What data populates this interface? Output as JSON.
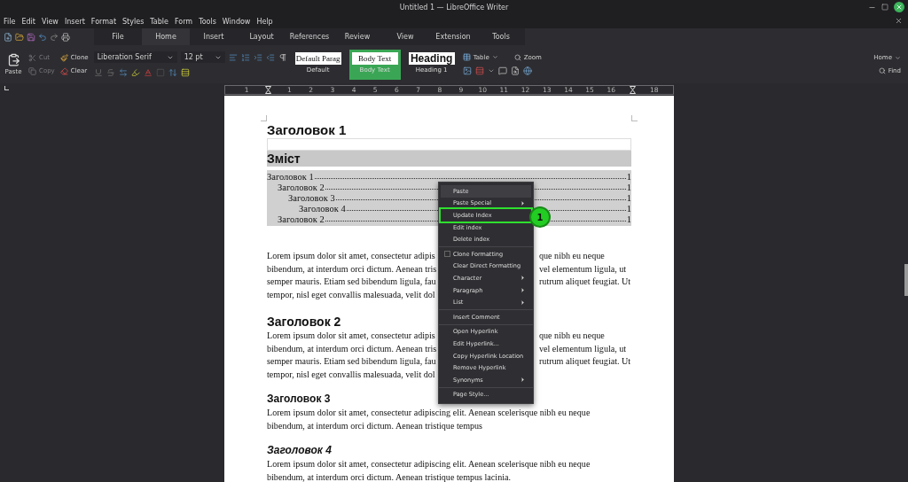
{
  "window": {
    "title": "Untitled 1 — LibreOffice Writer"
  },
  "menubar": [
    "File",
    "Edit",
    "View",
    "Insert",
    "Format",
    "Styles",
    "Table",
    "Form",
    "Tools",
    "Window",
    "Help"
  ],
  "tabs": [
    {
      "label": "File",
      "selected": false
    },
    {
      "label": "Home",
      "selected": true
    },
    {
      "label": "Insert",
      "selected": false
    },
    {
      "label": "Layout",
      "selected": false
    },
    {
      "label": "References",
      "selected": false
    },
    {
      "label": "Review",
      "selected": false
    },
    {
      "label": "View",
      "selected": false
    },
    {
      "label": "Extension",
      "selected": false
    },
    {
      "label": "Tools",
      "selected": false
    }
  ],
  "ribbon": {
    "paste": "Paste",
    "cut": {
      "label": "Cut",
      "disabled": true
    },
    "copy": {
      "label": "Copy",
      "disabled": true
    },
    "clone": {
      "label": "Clone",
      "disabled": false
    },
    "clear": {
      "label": "Clear",
      "disabled": false
    },
    "font_name": "Liberation Serif",
    "font_size": "12 pt",
    "styles": [
      {
        "preview": "Default Parag",
        "label": "Default",
        "selected": false,
        "kind": "paragraph"
      },
      {
        "preview": "Body Text",
        "label": "Body Text",
        "selected": true,
        "kind": "paragraph"
      },
      {
        "preview": "Heading",
        "label": "Heading 1",
        "selected": false,
        "kind": "heading"
      }
    ],
    "table": "Table",
    "zoom": "Zoom",
    "home_menu": "Home",
    "find": "Find"
  },
  "ruler": [
    {
      "kind": "number",
      "label": "1"
    },
    {
      "kind": "marker"
    },
    {
      "kind": "number",
      "label": "1"
    },
    {
      "kind": "number",
      "label": "2"
    },
    {
      "kind": "number",
      "label": "3"
    },
    {
      "kind": "number",
      "label": "4"
    },
    {
      "kind": "number",
      "label": "5"
    },
    {
      "kind": "number",
      "label": "6"
    },
    {
      "kind": "number",
      "label": "7"
    },
    {
      "kind": "number",
      "label": "8"
    },
    {
      "kind": "number",
      "label": "9"
    },
    {
      "kind": "number",
      "label": "10"
    },
    {
      "kind": "number",
      "label": "11"
    },
    {
      "kind": "number",
      "label": "12"
    },
    {
      "kind": "number",
      "label": "13"
    },
    {
      "kind": "number",
      "label": "14"
    },
    {
      "kind": "number",
      "label": "15"
    },
    {
      "kind": "number",
      "label": "16"
    },
    {
      "kind": "marker"
    },
    {
      "kind": "number",
      "label": "18"
    }
  ],
  "document": {
    "title": "Заголовок 1",
    "toc_title": "Зміст",
    "toc": [
      {
        "text": "Заголовок 1",
        "page": "1",
        "children": [
          {
            "text": "Заголовок 2",
            "page": "1",
            "children": [
              {
                "text": "Заголовок 3",
                "page": "1",
                "children": [
                  {
                    "text": "Заголовок 4",
                    "page": "1"
                  }
                ]
              }
            ]
          },
          {
            "text": "Заголовок 2",
            "page": "1"
          }
        ]
      }
    ],
    "blocks": [
      {
        "kind": "paragraph",
        "lines": [
          {
            "left": "Lorem ipsum dolor sit amet, consectetur adipis",
            "right": "que nibh eu neque"
          },
          {
            "left": "bibendum, at interdum orci dictum. Aenean tris",
            "right": "vel elementum ligula, ut"
          },
          {
            "left": "semper mauris. Etiam sed bibendum ligula, fau",
            "right": "rutrum aliquet feugiat. Ut"
          },
          {
            "left": "tempor, nisl eget convallis malesuada, velit dol"
          }
        ]
      },
      {
        "kind": "heading2",
        "text": "Заголовок 2"
      },
      {
        "kind": "paragraph",
        "lines": [
          {
            "left": "Lorem ipsum dolor sit amet, consectetur adipis",
            "right": "que nibh eu neque"
          },
          {
            "left": "bibendum, at interdum orci dictum. Aenean tris",
            "right": "vel elementum ligula, ut"
          },
          {
            "left": "semper mauris. Etiam sed bibendum ligula, fau",
            "right": "rutrum aliquet feugiat. Ut"
          },
          {
            "left": "tempor, nisl eget convallis malesuada, velit dol"
          }
        ]
      },
      {
        "kind": "heading3",
        "text": "Заголовок 3"
      },
      {
        "kind": "paragraph",
        "lines": [
          {
            "left": "Lorem ipsum dolor sit amet, consectetur adipiscing elit. Aenean scelerisque nibh eu neque"
          },
          {
            "left": "bibendum, at interdum orci dictum. Aenean tristique tempus"
          }
        ]
      },
      {
        "kind": "heading4",
        "text": "Заголовок 4"
      },
      {
        "kind": "paragraph",
        "lines": [
          {
            "left": "Lorem ipsum dolor sit amet, consectetur adipiscing elit. Aenean scelerisque nibh eu neque"
          },
          {
            "left": "bibendum, at interdum orci dictum. Aenean tristique tempus lacinia."
          }
        ]
      }
    ]
  },
  "context_menu": {
    "groups": [
      [
        {
          "label": "Paste",
          "kind": "command",
          "highlighted": true,
          "outlined": false
        },
        {
          "label": "Paste Special",
          "kind": "submenu",
          "highlighted": false,
          "outlined": false
        },
        {
          "label": "Update Index",
          "kind": "command",
          "highlighted": false,
          "outlined": true
        },
        {
          "label": "Edit index",
          "kind": "command",
          "highlighted": false,
          "outlined": false
        },
        {
          "label": "Delete index",
          "kind": "command",
          "highlighted": false,
          "outlined": false
        }
      ],
      [
        {
          "label": "Clone Formatting",
          "kind": "check",
          "checked": false,
          "highlighted": false,
          "outlined": false
        },
        {
          "label": "Clear Direct Formatting",
          "kind": "command",
          "highlighted": false,
          "outlined": false
        },
        {
          "label": "Character",
          "kind": "submenu",
          "highlighted": false,
          "outlined": false
        },
        {
          "label": "Paragraph",
          "kind": "submenu",
          "highlighted": false,
          "outlined": false
        },
        {
          "label": "List",
          "kind": "submenu",
          "highlighted": false,
          "outlined": false
        }
      ],
      [
        {
          "label": "Insert Comment",
          "kind": "command",
          "highlighted": false,
          "outlined": false
        }
      ],
      [
        {
          "label": "Open Hyperlink",
          "kind": "command",
          "highlighted": false,
          "outlined": false
        },
        {
          "label": "Edit Hyperlink...",
          "kind": "command",
          "highlighted": false,
          "outlined": false
        },
        {
          "label": "Copy Hyperlink Location",
          "kind": "command",
          "highlighted": false,
          "outlined": false
        },
        {
          "label": "Remove Hyperlink",
          "kind": "command",
          "highlighted": false,
          "outlined": false
        },
        {
          "label": "Synonyms",
          "kind": "submenu",
          "highlighted": false,
          "outlined": false
        }
      ],
      [
        {
          "label": "Page Style...",
          "kind": "command",
          "highlighted": false,
          "outlined": false
        }
      ]
    ],
    "callout": "1"
  }
}
